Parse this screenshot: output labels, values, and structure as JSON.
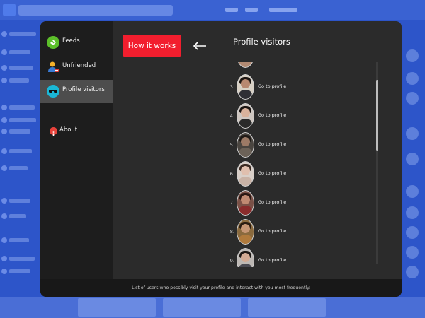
{
  "sidebar": {
    "items": [
      {
        "label": "Feeds",
        "icon": "feed-icon",
        "color": "#5cbf2a",
        "active": false
      },
      {
        "label": "Unfriended",
        "icon": "user-remove-icon",
        "color": "#f5b22a",
        "active": false
      },
      {
        "label": "Profile visitors",
        "icon": "sunglasses-icon",
        "color": "#1ab7d6",
        "active": true
      },
      {
        "label": "About",
        "icon": "info-icon",
        "color": "#e8423b",
        "active": false
      }
    ]
  },
  "main": {
    "how_button_label": "How it works",
    "back_arrow_icon": "arrow-left-icon",
    "title": "Profile visitors",
    "visitors": [
      {
        "index": "3.",
        "link": "Go to profile"
      },
      {
        "index": "4.",
        "link": "Go to profile"
      },
      {
        "index": "5.",
        "link": "Go to profile"
      },
      {
        "index": "6.",
        "link": "Go to profile"
      },
      {
        "index": "7.",
        "link": "Go to profile"
      },
      {
        "index": "8.",
        "link": "Go to profile"
      },
      {
        "index": "9.",
        "link": "Go to profile"
      }
    ]
  },
  "footer": {
    "text": "List of users who possibly visit your profile and interact with you most frequently."
  },
  "colors": {
    "accent_button": "#f21e2e",
    "modal_bg": "#2b2b2b",
    "sidebar_bg": "#1d1d1d",
    "background_page": "#2d55c9"
  }
}
